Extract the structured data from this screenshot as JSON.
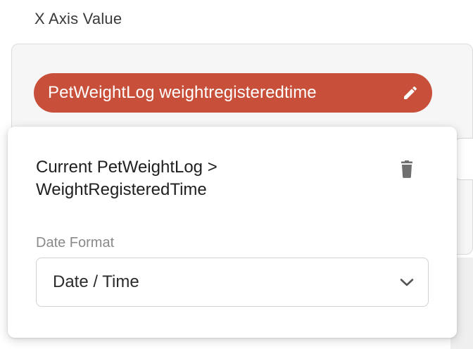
{
  "x_axis": {
    "label": "X Axis Value",
    "chip_label": "PetWeightLog weightregisteredtime",
    "chip_color": "#c8503a",
    "chip_icon": "pencil-icon"
  },
  "popover": {
    "source_line1": "Current PetWeightLog >",
    "source_line2": "WeightRegisteredTime",
    "delete_icon": "trash-icon",
    "date_format_label": "Date Format",
    "date_format_value": "Date / Time",
    "dropdown_icon": "chevron-down-icon"
  }
}
